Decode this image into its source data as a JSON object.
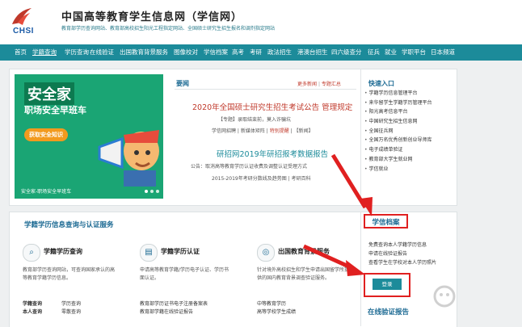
{
  "header": {
    "logo_text": "CHSI",
    "title": "中国高等教育学生信息网（学信网）",
    "subtitle": "教育部学历查询网站、教育部高校招生阳光工程指定网站、全国硕士研究生招生报名和调剂指定网站"
  },
  "nav": {
    "items": [
      "首页",
      "学籍查询",
      "学历查询",
      "在线验证",
      "出国教育背景服务",
      "图像校对",
      "学信档案",
      "高考",
      "考研",
      "政法招生",
      "港澳台招生",
      "四六级查分",
      "征兵",
      "就业",
      "学职平台",
      "日本频道"
    ],
    "active_index": 1
  },
  "banner": {
    "title": "安全家",
    "subtitle": "职场安全早班车",
    "button": "获取安全知识",
    "caption": "安全家-职场安全早班车"
  },
  "news": {
    "header": "要闻",
    "more": "更多新闻",
    "special": "专题汇总",
    "headline1": "2020年全国硕士研究生招生考试公告 管理规定",
    "line1": "【专题】录取结束前，莫入诈骗坑",
    "line2_a": "学信网招聘",
    "line2_b": "新媒体矩阵",
    "line2_c": "特别提醒",
    "line2_d": "【新闻】",
    "headline2": "研招网2019年研招报考数据报告",
    "line3": "公告：取消高等教育学历认证收费及调整认证受理方式",
    "line4": "2015-2019年考研分数线及趋势图 | 考研百科"
  },
  "quick": {
    "header": "快速入口",
    "items": [
      "学籍学历信息管理平台",
      "来华留学生学籍学历管理平台",
      "阳光高考信息平台",
      "中国研究生招生信息网",
      "全国征兵网",
      "全国万名优秀创新创业导师库",
      "电子成绩单验证",
      "教育部大学生就业网",
      "学信就业"
    ]
  },
  "services": {
    "header": "学籍学历信息查询与认证服务",
    "cards": [
      {
        "icon": "search-icon",
        "name": "学籍学历查询",
        "desc": "教育部学历查询网站，可查询国家承认的高等教育学籍学历信息。",
        "links": [
          "学籍查询",
          "学历查询",
          "本人查询",
          "零散查询"
        ]
      },
      {
        "icon": "document-icon",
        "name": "学籍学历认证",
        "desc": "申请高等教育学籍/学历电子认证、学历书面认证。",
        "links": [
          "教育部学历证书电子注册备案表",
          "教育部学籍在线验证报告"
        ]
      },
      {
        "icon": "globe-icon",
        "name": "出国教育背景服务",
        "desc": "针对境外高校招生和学生申请出国留学所提供的国内教育背景调查验证服务。",
        "links": [
          "中等教育学历",
          "高等学校学生成绩"
        ]
      }
    ]
  },
  "archive": {
    "header": "学信档案",
    "links": [
      "免费查询本人学籍学历信息",
      "申请在线验证报告",
      "查看学生在学校对本人学历照片"
    ],
    "login": "登录"
  },
  "verify_header": "在线验证报告",
  "colors": {
    "nav": "#1c8b9a",
    "accent_red": "#e02020",
    "link_blue": "#1c6a93"
  }
}
